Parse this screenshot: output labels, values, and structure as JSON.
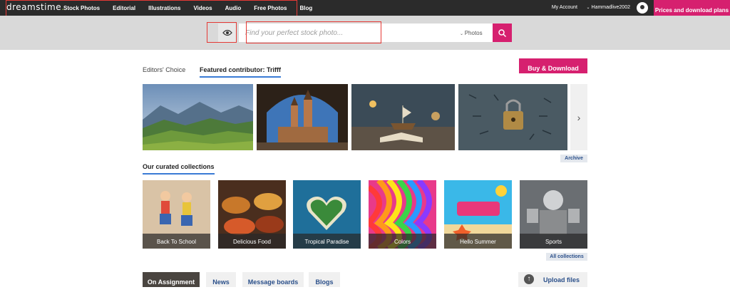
{
  "header": {
    "logo_text": "dreamstime",
    "nav": [
      "Stock Photos",
      "Editorial",
      "Illustrations",
      "Videos",
      "Audio",
      "Free Photos",
      "Blog"
    ],
    "my_account": "My Account",
    "username": "Hammadlive2002",
    "pricing_button": "Prices and download plans"
  },
  "search": {
    "placeholder": "Find your perfect stock photo...",
    "value": "",
    "type_selected": "Photos",
    "eye_icon": "eye-icon",
    "search_icon": "search-icon"
  },
  "featured": {
    "tabs": [
      {
        "label": "Editors' Choice",
        "active": false
      },
      {
        "label": "Featured contributor: Trifff",
        "active": true
      }
    ],
    "buy_button": "Buy & Download",
    "archive_label": "Archive",
    "next_icon": "chevron-right-icon"
  },
  "collections": {
    "heading": "Our curated collections",
    "items": [
      {
        "label": "Back To School"
      },
      {
        "label": "Delicious Food"
      },
      {
        "label": "Tropical Paradise"
      },
      {
        "label": "Colors"
      },
      {
        "label": "Hello Summer"
      },
      {
        "label": "Sports"
      }
    ],
    "all_label": "All collections"
  },
  "bottom": {
    "buttons": [
      {
        "label": "On Assignment"
      },
      {
        "label": "News"
      },
      {
        "label": "Message boards"
      },
      {
        "label": "Blogs"
      }
    ],
    "upload_label": "Upload files",
    "upload_icon": "arrow-up-icon"
  },
  "colors": {
    "accent": "#d6206f",
    "topbar": "#2b2b2b",
    "link": "#2a4f8a",
    "tab_underline": "#3a7bd5"
  }
}
